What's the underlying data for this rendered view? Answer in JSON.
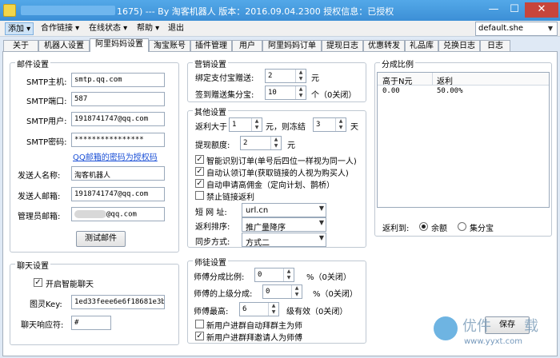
{
  "window": {
    "title": "1675) --- By 淘客机器人 版本：2016.09.04.2300 授权信息：已授权",
    "controls": {
      "minimize": "—",
      "maximize": "☐",
      "close": "✕"
    }
  },
  "menu": {
    "items": [
      "添加",
      "合作链接",
      "在线状态",
      "帮助",
      "退出"
    ],
    "config_select": "default.she"
  },
  "tabs": [
    "关于",
    "机器人设置",
    "阿里妈妈设置",
    "淘宝账号",
    "插件管理",
    "用户",
    "阿里妈妈订单",
    "提现日志",
    "优惠转发",
    "礼品库",
    "兑换日志",
    "日志"
  ],
  "mail": {
    "title": "邮件设置",
    "smtp_host_label": "SMTP主机:",
    "smtp_host": "smtp.qq.com",
    "smtp_port_label": "SMTP端口:",
    "smtp_port": "587",
    "smtp_user_label": "SMTP用户:",
    "smtp_user": "1918741747@qq.com",
    "smtp_pass_label": "SMTP密码:",
    "smtp_pass": "****************",
    "qq_link": "QQ邮箱的密码为授权码",
    "sender_name_label": "发送人名称:",
    "sender_name": "淘客机器人",
    "sender_mail_label": "发送人邮箱:",
    "sender_mail": "1918741747@qq.com",
    "admin_mail_label": "管理员邮箱:",
    "admin_mail": "@qq.com",
    "test_button": "测试邮件"
  },
  "chat": {
    "title": "聊天设置",
    "smart_chat": "开启智能聊天",
    "key_label": "图灵Key:",
    "key": "1ed33feee6e6f18681e3b",
    "reply_label": "聊天响应符:",
    "reply": "#"
  },
  "marketing": {
    "title": "营销设置",
    "bind_label": "绑定支付宝赠送:",
    "bind_value": "2",
    "bind_unit": "元",
    "signin_label": "签到赠送集分宝:",
    "signin_value": "10",
    "signin_unit": "个（0关闭）"
  },
  "other": {
    "title": "其他设置",
    "rebate_label": "返利大于",
    "rebate_value": "1",
    "rebate_mid": "元，则冻结",
    "freeze_value": "3",
    "freeze_unit": "天",
    "withdraw_label": "提现额度:",
    "withdraw_value": "2",
    "withdraw_unit": "元",
    "opt1": "智能识别订单(单号后四位一样视为同一人)",
    "opt2": "自动认领订单(获取链接的人视为购买人)",
    "opt3": "自动申请高佣金（定向计划、鹊桥）",
    "opt4": "禁止链接返利",
    "short_label": "短 网 址:",
    "short_value": "url.cn",
    "sort_label": "返利排序:",
    "sort_value": "推广量降序",
    "sync_label": "同步方式:",
    "sync_value": "方式二"
  },
  "mentor": {
    "title": "师徒设置",
    "share_label": "师傅分成比例:",
    "share_value": "0",
    "share_unit": "%（0关闭）",
    "upper_label": "师傅的上级分成:",
    "upper_value": "0",
    "upper_unit": "%（0关闭）",
    "max_label": "师傅最高:",
    "max_value": "6",
    "max_unit": "级有效（0关闭）",
    "opt1": "新用户进群自动拜群主为师",
    "opt2": "新用户进群拜邀请人为师傅"
  },
  "ratio": {
    "title": "分成比例",
    "col1": "高于N元",
    "col2": "返利",
    "rows": [
      {
        "n": "0.00",
        "pct": "50.00%"
      }
    ],
    "to_label": "返利到:",
    "opt_balance": "余额",
    "opt_jfb": "集分宝"
  },
  "save_button": "保存",
  "watermark": {
    "brand": "优件",
    "sub": "载",
    "url": "www.yyxt.com"
  }
}
